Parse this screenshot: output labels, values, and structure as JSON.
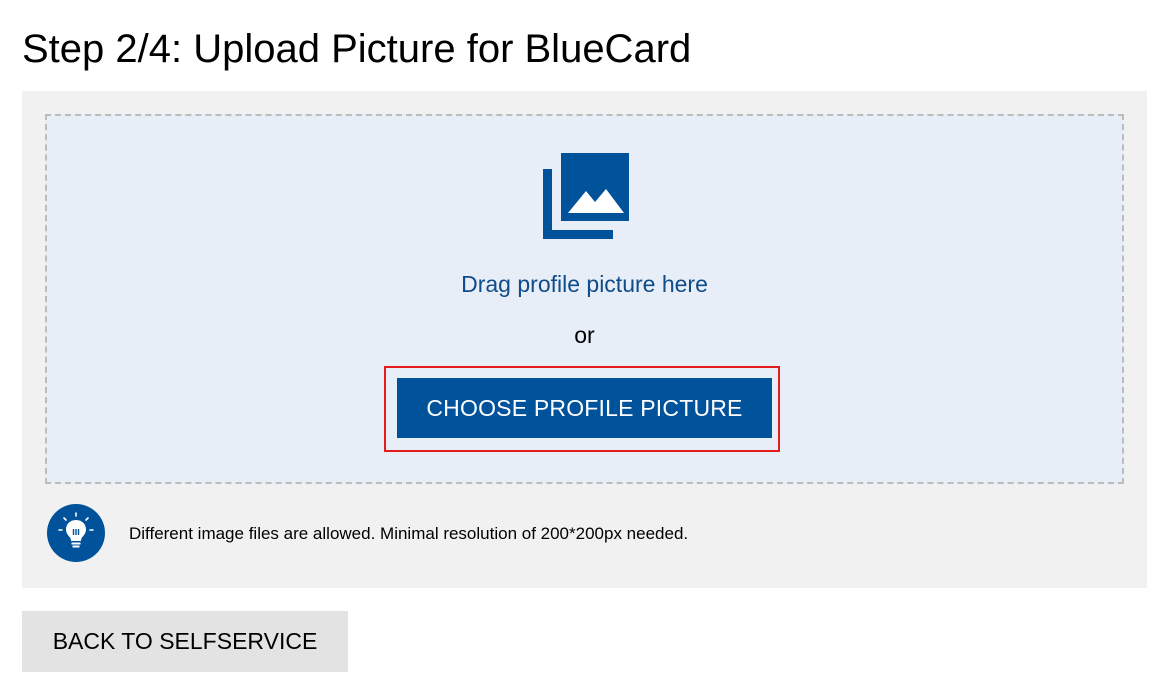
{
  "header": {
    "title": "Step 2/4: Upload Picture for BlueCard"
  },
  "upload": {
    "icon": "image-gallery-icon",
    "drag_text": "Drag profile picture here",
    "or_text": "or",
    "choose_button_label": "CHOOSE PROFILE PICTURE"
  },
  "hint": {
    "icon": "lightbulb-icon",
    "text": "Different image files are allowed. Minimal resolution of 200*200px needed."
  },
  "footer": {
    "back_button_label": "BACK TO SELFSERVICE"
  },
  "colors": {
    "brand_blue": "#00529b",
    "link_blue": "#0f4c8a",
    "dropzone_bg": "#e8eef7",
    "panel_bg": "#f1f1f1",
    "highlight_red": "#e51c1c",
    "secondary_button_bg": "#e3e3e3"
  }
}
